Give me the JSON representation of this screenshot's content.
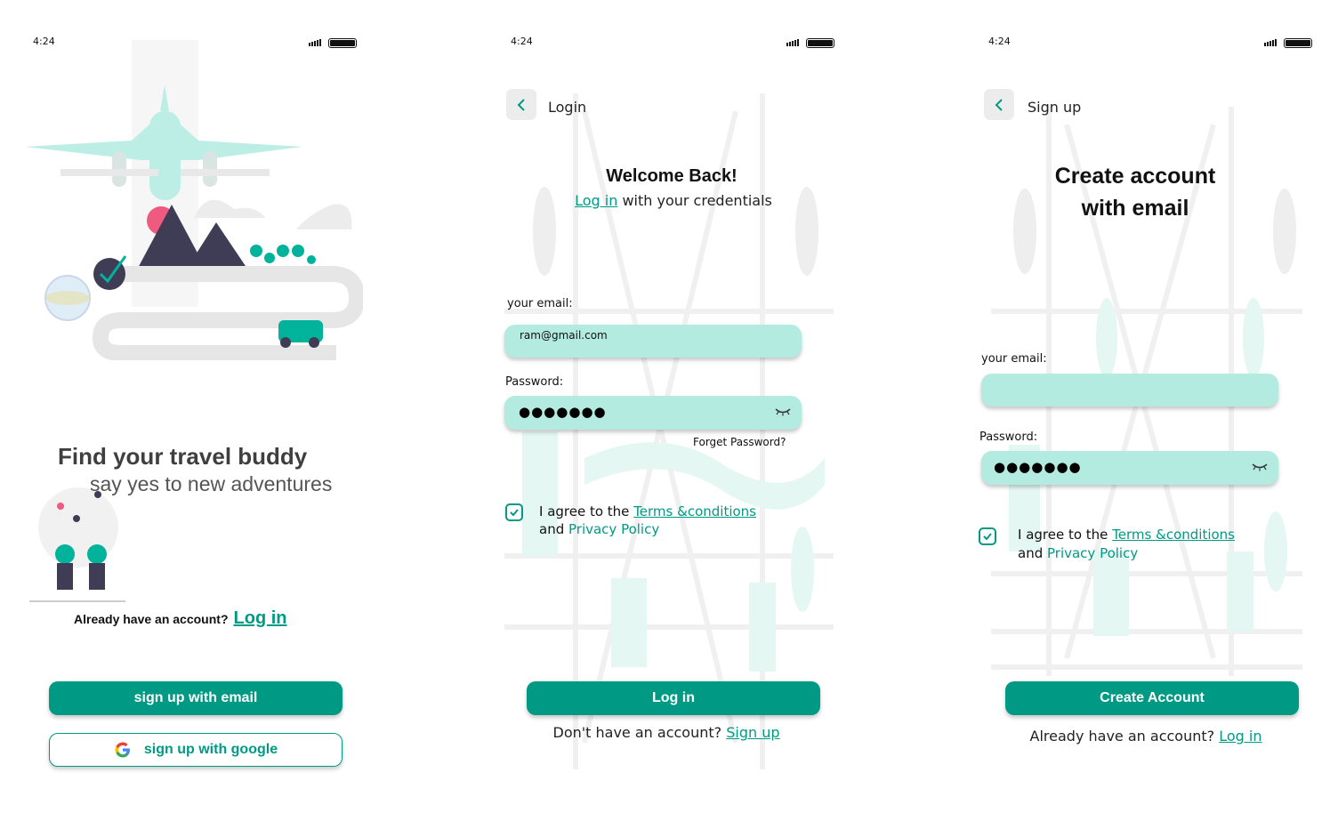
{
  "screens": {
    "welcome": {
      "time": "4:24",
      "headline": "Find your travel buddy",
      "subheadline": "say yes to new adventures",
      "already_text": "Already have an account?",
      "login_link": "Log in",
      "email_button": "sign up with email",
      "google_button": "sign up with google"
    },
    "login": {
      "time": "4:24",
      "header_title": "Login",
      "welcome": "Welcome Back!",
      "sub_link": "Log in",
      "sub_rest": " with your credentials",
      "email_label": "your email:",
      "email_value": "ram@gmail.com",
      "password_label": "Password:",
      "password_value": "●●●●●●●",
      "forgot": "Forget Password?",
      "agree_prefix": "I agree to the ",
      "terms": "Terms &conditions",
      "and_text": "and ",
      "privacy": "Privacy Policy",
      "login_button": "Log in",
      "no_account": "Don't have an account?",
      "signup_link": "Sign up"
    },
    "signup": {
      "time": "4:24",
      "header_title": "Sign up",
      "title_line1": "Create account",
      "title_line2": "with email",
      "email_label": "your email:",
      "email_value": "",
      "password_label": "Password:",
      "password_value": "●●●●●●●",
      "agree_prefix": "I agree to the ",
      "terms": "Terms &conditions",
      "and_text": "and ",
      "privacy": "Privacy Policy",
      "create_button": "Create Account",
      "already_text": "Already have an account?",
      "login_link": "Log in"
    }
  },
  "colors": {
    "accent": "#009a84",
    "field": "#b3ebe1",
    "illustration_mint": "#bdeee5"
  },
  "icons": [
    "signal-icon",
    "battery-icon",
    "back-chevron-icon",
    "eye-closed-icon",
    "checkbox-checked-icon",
    "google-icon",
    "airplane-illustration",
    "handshake-illustration",
    "city-background-illustration"
  ]
}
